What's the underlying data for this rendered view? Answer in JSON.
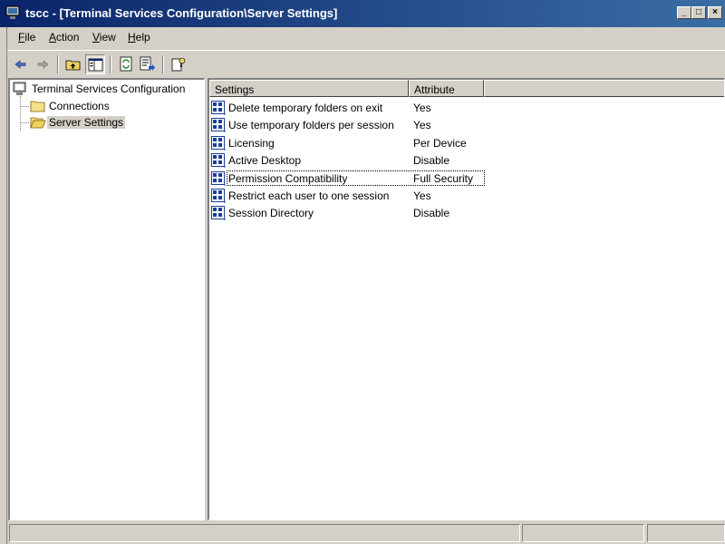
{
  "window": {
    "title": "tscc - [Terminal Services Configuration\\Server Settings]",
    "controls": {
      "minimize": "_",
      "maximize": "□",
      "close": "×"
    }
  },
  "menu": {
    "items": [
      {
        "label": "File",
        "mnemonic": "F"
      },
      {
        "label": "Action",
        "mnemonic": "A"
      },
      {
        "label": "View",
        "mnemonic": "V"
      },
      {
        "label": "Help",
        "mnemonic": "H"
      }
    ]
  },
  "toolbar": {
    "buttons": [
      "back-icon",
      "forward-icon",
      "up-folder-icon",
      "show-hide-tree-icon",
      "refresh-icon",
      "export-list-icon",
      "help-icon"
    ]
  },
  "tree": {
    "root": "Terminal Services Configuration",
    "children": [
      "Connections",
      "Server Settings"
    ],
    "selected": "Server Settings"
  },
  "list": {
    "columns": [
      "Settings",
      "Attribute"
    ],
    "rows": [
      {
        "setting": "Delete temporary folders on exit",
        "attribute": "Yes"
      },
      {
        "setting": "Use temporary folders per session",
        "attribute": "Yes"
      },
      {
        "setting": "Licensing",
        "attribute": "Per Device"
      },
      {
        "setting": "Active Desktop",
        "attribute": "Disable"
      },
      {
        "setting": "Permission Compatibility",
        "attribute": "Full Security"
      },
      {
        "setting": "Restrict each user to one session",
        "attribute": "Yes"
      },
      {
        "setting": "Session Directory",
        "attribute": "Disable"
      }
    ],
    "focused_row": 4
  },
  "colors": {
    "titlebar_start": "#0a246a",
    "titlebar_end": "#3a6ea5",
    "face": "#d4d0c8"
  }
}
